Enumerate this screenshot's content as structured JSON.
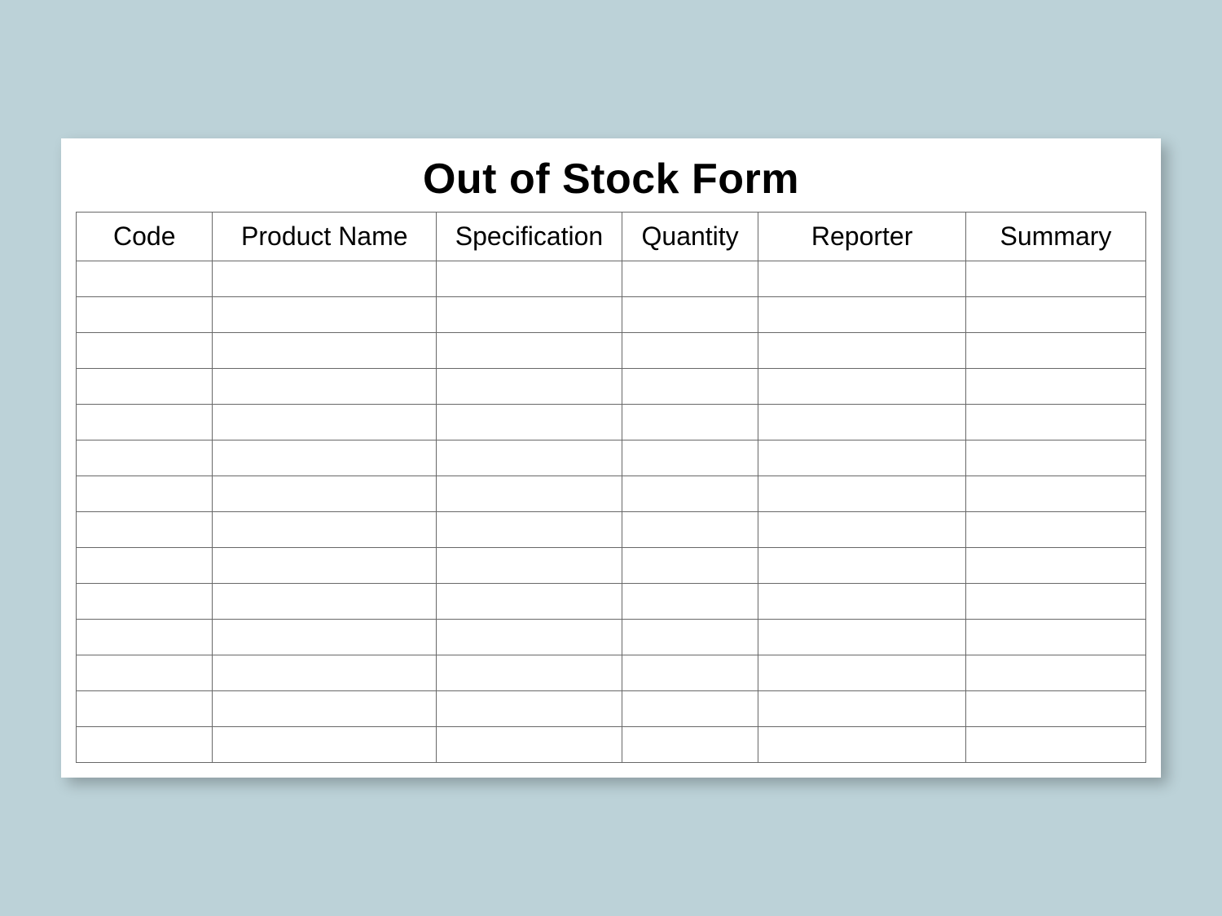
{
  "form": {
    "title": "Out of Stock Form",
    "columns": [
      "Code",
      "Product Name",
      "Specification",
      "Quantity",
      "Reporter",
      "Summary"
    ],
    "rows": [
      [
        "",
        "",
        "",
        "",
        "",
        ""
      ],
      [
        "",
        "",
        "",
        "",
        "",
        ""
      ],
      [
        "",
        "",
        "",
        "",
        "",
        ""
      ],
      [
        "",
        "",
        "",
        "",
        "",
        ""
      ],
      [
        "",
        "",
        "",
        "",
        "",
        ""
      ],
      [
        "",
        "",
        "",
        "",
        "",
        ""
      ],
      [
        "",
        "",
        "",
        "",
        "",
        ""
      ],
      [
        "",
        "",
        "",
        "",
        "",
        ""
      ],
      [
        "",
        "",
        "",
        "",
        "",
        ""
      ],
      [
        "",
        "",
        "",
        "",
        "",
        ""
      ],
      [
        "",
        "",
        "",
        "",
        "",
        ""
      ],
      [
        "",
        "",
        "",
        "",
        "",
        ""
      ],
      [
        "",
        "",
        "",
        "",
        "",
        ""
      ],
      [
        "",
        "",
        "",
        "",
        "",
        ""
      ]
    ]
  }
}
